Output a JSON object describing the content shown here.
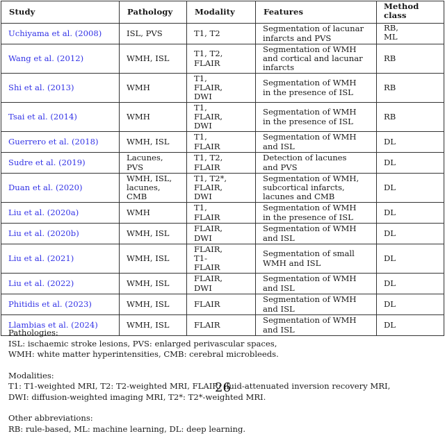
{
  "table": {
    "headers": {
      "study": "Study",
      "pathology": "Pathology",
      "modality": "Modality",
      "features": "Features",
      "method_line1": "Method",
      "method_line2": "class"
    },
    "link_color": "#3333e6",
    "rows": [
      {
        "study": "Uchiyama et al. (2008)",
        "pathology": [
          "ISL, PVS"
        ],
        "modality": [
          "T1, T2"
        ],
        "features": [
          "Segmentation of lacunar",
          "infarcts and PVS"
        ],
        "method": [
          "RB,",
          "ML"
        ]
      },
      {
        "study": "Wang et al. (2012)",
        "pathology": [
          "WMH, ISL"
        ],
        "modality": [
          "T1, T2,",
          "FLAIR"
        ],
        "features": [
          "Segmentation of WMH",
          "and cortical and lacunar",
          "infarcts"
        ],
        "method": [
          "RB"
        ]
      },
      {
        "study": "Shi et al. (2013)",
        "pathology": [
          "WMH"
        ],
        "modality": [
          "T1,",
          "FLAIR,",
          "DWI"
        ],
        "features": [
          "Segmentation of WMH",
          "in the presence of ISL"
        ],
        "method": [
          "RB"
        ]
      },
      {
        "study": "Tsai et al. (2014)",
        "pathology": [
          "WMH"
        ],
        "modality": [
          "T1,",
          "FLAIR,",
          "DWI"
        ],
        "features": [
          "Segmentation of WMH",
          "in the presence of ISL"
        ],
        "method": [
          "RB"
        ]
      },
      {
        "study": "Guerrero et al. (2018)",
        "pathology": [
          "WMH, ISL"
        ],
        "modality": [
          "T1,",
          "FLAIR"
        ],
        "features": [
          "Segmentation of WMH",
          "and ISL"
        ],
        "method": [
          "DL"
        ]
      },
      {
        "study": "Sudre et al. (2019)",
        "pathology": [
          "Lacunes,",
          "PVS"
        ],
        "modality": [
          "T1, T2,",
          "FLAIR"
        ],
        "features": [
          "Detection of lacunes",
          "and PVS"
        ],
        "method": [
          "DL"
        ]
      },
      {
        "study": "Duan et al. (2020)",
        "pathology": [
          "WMH, ISL,",
          "lacunes,",
          "CMB"
        ],
        "modality": [
          "T1, T2*,",
          "FLAIR,",
          "DWI"
        ],
        "features": [
          "Segmentation of WMH,",
          "subcortical infarcts,",
          "lacunes and CMB"
        ],
        "method": [
          "DL"
        ]
      },
      {
        "study": "Liu et al. (2020a)",
        "pathology": [
          "WMH"
        ],
        "modality": [
          "T1,",
          "FLAIR"
        ],
        "features": [
          "Segmentation of WMH",
          "in the presence of ISL"
        ],
        "method": [
          "DL"
        ]
      },
      {
        "study": "Liu et al. (2020b)",
        "pathology": [
          "WMH, ISL"
        ],
        "modality": [
          "FLAIR,",
          "DWI"
        ],
        "features": [
          "Segmentation of WMH",
          "and ISL"
        ],
        "method": [
          "DL"
        ]
      },
      {
        "study": "Liu et al. (2021)",
        "pathology": [
          "WMH, ISL"
        ],
        "modality": [
          "FLAIR,",
          "T1-",
          "FLAIR"
        ],
        "features": [
          "Segmentation of small",
          "WMH and ISL"
        ],
        "method": [
          "DL"
        ]
      },
      {
        "study": "Liu et al. (2022)",
        "pathology": [
          "WMH, ISL"
        ],
        "modality": [
          "FLAIR,",
          "DWI"
        ],
        "features": [
          "Segmentation of WMH",
          "and ISL"
        ],
        "method": [
          "DL"
        ]
      },
      {
        "study": "Phitidis et al. (2023)",
        "pathology": [
          "WMH, ISL"
        ],
        "modality": [
          "FLAIR"
        ],
        "features": [
          "Segmentation of WMH",
          "and ISL"
        ],
        "method": [
          "DL"
        ]
      },
      {
        "study": "Llambias et al. (2024)",
        "pathology": [
          "WMH, ISL"
        ],
        "modality": [
          "FLAIR"
        ],
        "features": [
          "Segmentation of WMH",
          "and ISL"
        ],
        "method": [
          "DL"
        ]
      }
    ]
  },
  "notes": {
    "pathologies": {
      "title": "Pathologies:",
      "lines": [
        "ISL: ischaemic stroke lesions, PVS: enlarged perivascular spaces,",
        "WMH: white matter hyperintensities, CMB: cerebral microbleeds."
      ]
    },
    "modalities": {
      "title": "Modalities:",
      "lines": [
        "T1: T1-weighted MRI, T2: T2-weighted MRI, FLAIR: fluid-attenuated inversion recovery MRI,",
        "DWI: diffusion-weighted imaging MRI, T2*: T2*-weighted MRI."
      ]
    },
    "other": {
      "title": "Other abbreviations:",
      "lines": [
        "RB: rule-based, ML: machine learning, DL: deep learning."
      ]
    }
  },
  "page_number": "26"
}
